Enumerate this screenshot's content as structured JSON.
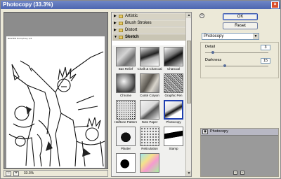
{
  "window": {
    "title": "Photocopy (33.3%)",
    "close_glyph": "×"
  },
  "preview": {
    "caption": "BUSTER Humphrey 1/4",
    "zoom_minus": "−",
    "zoom_plus": "+",
    "zoom_value": "33.3%"
  },
  "gallery": {
    "folders": [
      {
        "label": "Artistic",
        "expanded": false,
        "glyph": "▶"
      },
      {
        "label": "Brush Strokes",
        "expanded": false,
        "glyph": "▶"
      },
      {
        "label": "Distort",
        "expanded": false,
        "glyph": "▶"
      },
      {
        "label": "Sketch",
        "expanded": true,
        "glyph": "▼"
      }
    ],
    "thumbs": [
      {
        "label": "Bas Relief",
        "icon": "bas-relief-icon",
        "selected": false
      },
      {
        "label": "Chalk & Charcoal",
        "icon": "chalk-charcoal-icon",
        "selected": false
      },
      {
        "label": "Charcoal",
        "icon": "charcoal-icon",
        "selected": false
      },
      {
        "label": "Chrome",
        "icon": "chrome-icon",
        "selected": false
      },
      {
        "label": "Conté Crayon",
        "icon": "conte-crayon-icon",
        "selected": false
      },
      {
        "label": "Graphic Pen",
        "icon": "graphic-pen-icon",
        "selected": false
      },
      {
        "label": "Halftone Pattern",
        "icon": "halftone-pattern-icon",
        "selected": false
      },
      {
        "label": "Note Paper",
        "icon": "note-paper-icon",
        "selected": false
      },
      {
        "label": "Photocopy",
        "icon": "photocopy-icon",
        "selected": true
      },
      {
        "label": "Plaster",
        "icon": "plaster-icon",
        "selected": false
      },
      {
        "label": "Reticulation",
        "icon": "reticulation-icon",
        "selected": false
      },
      {
        "label": "Stamp",
        "icon": "stamp-icon",
        "selected": false
      },
      {
        "label": "",
        "icon": "torn-edges-icon",
        "selected": false
      },
      {
        "label": "",
        "icon": "water-paper-icon",
        "selected": false
      }
    ]
  },
  "right": {
    "collapse_glyph": "«",
    "ok_label": "OK",
    "reset_label": "Reset",
    "filter_select": "Photocopy",
    "select_arrow": "▼",
    "params": [
      {
        "label": "Detail",
        "value": "3",
        "fraction": 0.1
      },
      {
        "label": "Darkness",
        "value": "15",
        "fraction": 0.3
      }
    ],
    "layer": {
      "name": "Photocopy",
      "eye_glyph": "◉"
    },
    "layer_new_glyph": "▫",
    "layer_delete_glyph": "▪"
  },
  "colors": {
    "accent": "#2a49a8",
    "title_bar": "#5a71ba",
    "preview_bg": "#8c8c8c"
  }
}
